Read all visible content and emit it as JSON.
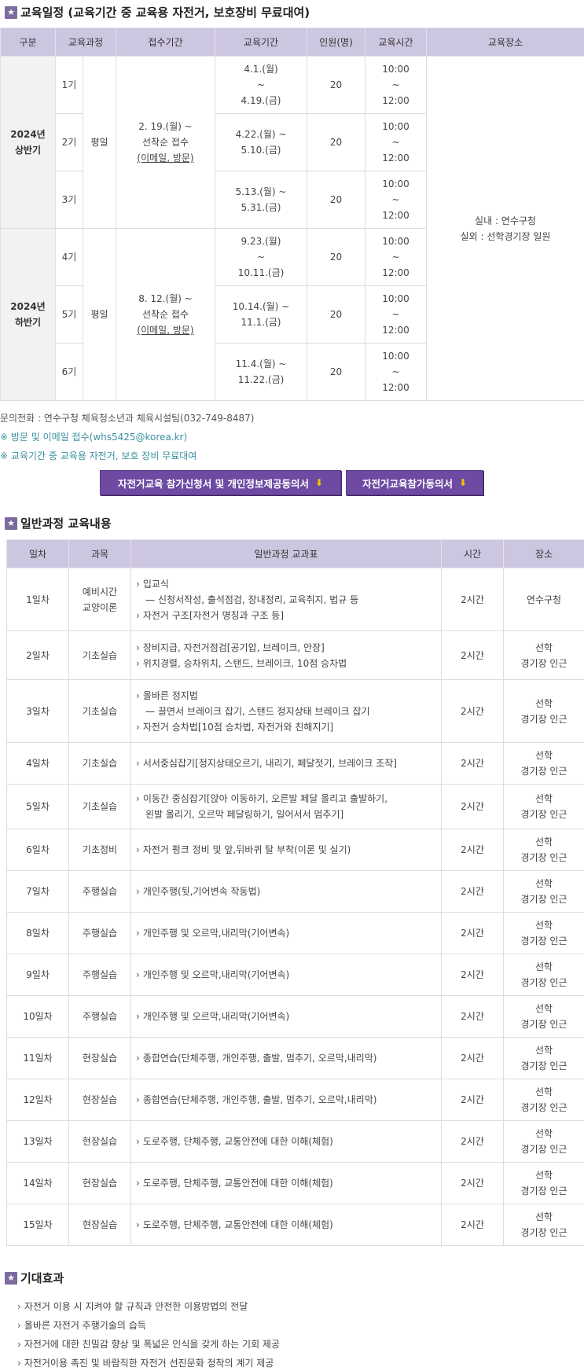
{
  "schedule": {
    "title": "교육일정 (교육기간 중 교육용 자전거, 보호장비 무료대여)",
    "headers": [
      "구분",
      "교육과정",
      "접수기간",
      "교육기간",
      "인원(명)",
      "교육시간",
      "교육장소"
    ],
    "halves": [
      {
        "label": [
          "2024년",
          "상반기"
        ],
        "course": "평일",
        "reception": [
          "2. 19.(월) ~",
          "선착순 접수"
        ],
        "reception_note": "(이메일, 방문)",
        "rows": [
          {
            "no": "1기",
            "period": [
              "4.1.(월)",
              "~",
              "4.19.(금)"
            ],
            "people": "20",
            "time": [
              "10:00",
              "~",
              "12:00"
            ]
          },
          {
            "no": "2기",
            "period": [
              "4.22.(월) ~",
              "5.10.(금)"
            ],
            "people": "20",
            "time": [
              "10:00",
              "~",
              "12:00"
            ]
          },
          {
            "no": "3기",
            "period": [
              "5.13.(월) ~",
              "5.31.(금)"
            ],
            "people": "20",
            "time": [
              "10:00",
              "~",
              "12:00"
            ]
          }
        ]
      },
      {
        "label": [
          "2024년",
          "하반기"
        ],
        "course": "평일",
        "reception": [
          "8. 12.(월) ~",
          "선착순 접수"
        ],
        "reception_note": "(이메일, 방문)",
        "rows": [
          {
            "no": "4기",
            "period": [
              "9.23.(월)",
              "~",
              "10.11.(금)"
            ],
            "people": "20",
            "time": [
              "10:00",
              "~",
              "12:00"
            ]
          },
          {
            "no": "5기",
            "period": [
              "10.14.(월) ~",
              "11.1.(금)"
            ],
            "people": "20",
            "time": [
              "10:00",
              "~",
              "12:00"
            ]
          },
          {
            "no": "6기",
            "period": [
              "11.4.(월) ~",
              "11.22.(금)"
            ],
            "people": "20",
            "time": [
              "10:00",
              "~",
              "12:00"
            ]
          }
        ]
      }
    ],
    "place": [
      "실내 : 연수구청",
      "실외 : 선학경기장 일원"
    ]
  },
  "notes": [
    "문의전화 : 연수구청 체육청소년과 체육시설팀(032-749-8487)",
    "※ 방문 및 이메일 접수(whs5425@korea.kr)",
    "※ 교육기간 중 교육용 자전거, 보호 장비 무료대여"
  ],
  "buttons": {
    "application": "자전거교육 참가신청서 및 개인정보제공동의서",
    "consent": "자전거교육참가동의서",
    "download_icon": "download-icon"
  },
  "curriculum": {
    "title": "일반과정 교육내용",
    "headers": [
      "일차",
      "과목",
      "일반과정 교과표",
      "시간",
      "장소"
    ],
    "rows": [
      {
        "day": "1일차",
        "subject": [
          "예비시간",
          "교양이론"
        ],
        "items": [
          {
            "t": "입교식",
            "sub": "신청서작성, 출석점검, 장내정리, 교육취지, 법규 등"
          },
          {
            "t": "자전거 구조[자전거 명칭과 구조 등]"
          }
        ],
        "time": "2시간",
        "place": [
          "연수구청"
        ]
      },
      {
        "day": "2일차",
        "subject": [
          "기초실습"
        ],
        "items": [
          {
            "t": "장비지급, 자전거점검[공기압, 브레이크, 안장]"
          },
          {
            "t": "위치경렬, 승차위치, 스탠드, 브레이크, 10점 승차법"
          }
        ],
        "time": "2시간",
        "place": [
          "선학",
          "경기장 인근"
        ]
      },
      {
        "day": "3일차",
        "subject": [
          "기초실습"
        ],
        "items": [
          {
            "t": "올바른 정지법",
            "sub": "끌면서 브레이크 잡기, 스탠드 정지상태 브레이크 잡기"
          },
          {
            "t": "자전거 승차법[10점 승차법, 자전거와 친해지기]"
          }
        ],
        "time": "2시간",
        "place": [
          "선학",
          "경기장 인근"
        ]
      },
      {
        "day": "4일차",
        "subject": [
          "기초실습"
        ],
        "items": [
          {
            "t": "서서중심잡기[정지상태오르기, 내리기, 페달젓기, 브레이크 조작]"
          }
        ],
        "time": "2시간",
        "place": [
          "선학",
          "경기장 인근"
        ]
      },
      {
        "day": "5일차",
        "subject": [
          "기초실습"
        ],
        "items": [
          {
            "t": "이동간 중심잡기[앉아 이동하기, 오른발 페달 올리고 출발하기,",
            "cont": "왼발 올리기, 오르막 페달링하기, 일어서서 멈추기]"
          }
        ],
        "time": "2시간",
        "place": [
          "선학",
          "경기장 인근"
        ]
      },
      {
        "day": "6일차",
        "subject": [
          "기초정비"
        ],
        "items": [
          {
            "t": "자전거 펑크 정비 및 앞,뒤바퀴 탈 부착(이론 및 실기)"
          }
        ],
        "time": "2시간",
        "place": [
          "선학",
          "경기장 인근"
        ]
      },
      {
        "day": "7일차",
        "subject": [
          "주행실습"
        ],
        "items": [
          {
            "t": "개인주행(뒷,기어변속 작동법)"
          }
        ],
        "time": "2시간",
        "place": [
          "선학",
          "경기장 인근"
        ]
      },
      {
        "day": "8일차",
        "subject": [
          "주행실습"
        ],
        "items": [
          {
            "t": "개인주행 및 오르막,내리막(기어변속)"
          }
        ],
        "time": "2시간",
        "place": [
          "선학",
          "경기장 인근"
        ]
      },
      {
        "day": "9일차",
        "subject": [
          "주행실습"
        ],
        "items": [
          {
            "t": "개인주행 및 오르막,내리막(기어변속)"
          }
        ],
        "time": "2시간",
        "place": [
          "선학",
          "경기장 인근"
        ]
      },
      {
        "day": "10일차",
        "subject": [
          "주행실습"
        ],
        "items": [
          {
            "t": "개인주행 및 오르막,내리막(기어변속)"
          }
        ],
        "time": "2시간",
        "place": [
          "선학",
          "경기장 인근"
        ]
      },
      {
        "day": "11일차",
        "subject": [
          "현장실습"
        ],
        "items": [
          {
            "t": "종합연습(단체주행, 개인주행, 출발, 멈추기, 오르막,내리막)"
          }
        ],
        "time": "2시간",
        "place": [
          "선학",
          "경기장 인근"
        ]
      },
      {
        "day": "12일차",
        "subject": [
          "현장실습"
        ],
        "items": [
          {
            "t": "종합연습(단체주행, 개인주행, 출발, 멈추기, 오르막,내리막)"
          }
        ],
        "time": "2시간",
        "place": [
          "선학",
          "경기장 인근"
        ]
      },
      {
        "day": "13일차",
        "subject": [
          "현장실습"
        ],
        "items": [
          {
            "t": "도로주행, 단체주행, 교통안전에 대한 이해(체험)"
          }
        ],
        "time": "2시간",
        "place": [
          "선학",
          "경기장 인근"
        ]
      },
      {
        "day": "14일차",
        "subject": [
          "현장실습"
        ],
        "items": [
          {
            "t": "도로주행, 단체주행, 교통안전에 대한 이해(체험)"
          }
        ],
        "time": "2시간",
        "place": [
          "선학",
          "경기장 인근"
        ]
      },
      {
        "day": "15일차",
        "subject": [
          "현장실습"
        ],
        "items": [
          {
            "t": "도로주행, 단체주행, 교통안전에 대한 이해(체험)"
          }
        ],
        "time": "2시간",
        "place": [
          "선학",
          "경기장 인근"
        ]
      }
    ]
  },
  "effects": {
    "title": "기대효과",
    "items": [
      "자전거 이용 시 지켜야 할 규칙과 안전한 이용방법의 전달",
      "올바른 자전거 주행기술의 습득",
      "자전거에 대한 친밀감 향상 및 폭넓은 인식을 갖게 하는 기회 제공",
      "자전거이용 촉진 및 바람직한 자전거 선진문화 정착의 계기 제공"
    ]
  },
  "colors": {
    "header_bg": "#cdc6e0",
    "button_bg": "#6e4aa3",
    "star_box": "#7b6a9e",
    "notice_teal": "#3a8fa0",
    "download_arrow": "#f3c400"
  }
}
